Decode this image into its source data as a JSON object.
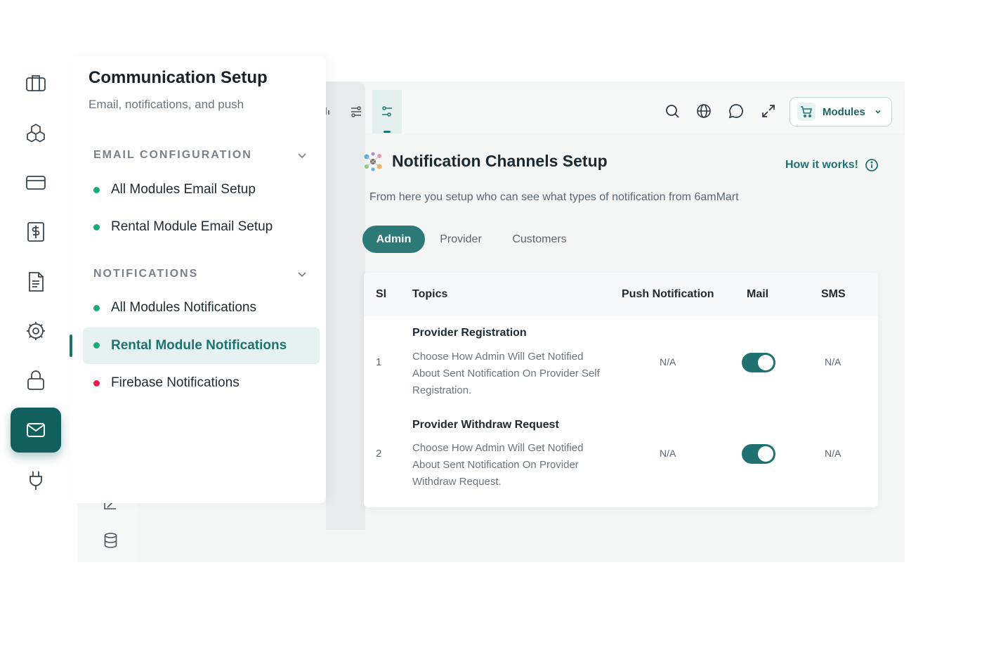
{
  "rail": {
    "icons": [
      "briefcase-icon",
      "cubes-icon",
      "card-icon",
      "dollar-receipt-icon",
      "document-icon",
      "settings-gear-icon",
      "lock-icon",
      "mail-icon",
      "plug-icon"
    ],
    "active": "mail-icon"
  },
  "panel": {
    "title": "Communication Setup",
    "subtitle": "Email, notifications, and push",
    "sections": [
      {
        "heading": "EMAIL CONFIGURATION",
        "items": [
          {
            "label": "All Modules Email Setup",
            "dot_color": "#1bab76"
          },
          {
            "label": "Rental Module Email Setup",
            "dot_color": "#1bab76"
          }
        ]
      },
      {
        "heading": "NOTIFICATIONS",
        "items": [
          {
            "label": "All Modules Notifications",
            "dot_color": "#1bab76"
          },
          {
            "label": "Rental Module Notifications",
            "dot_color": "#1bab76",
            "active": true
          },
          {
            "label": "Firebase Notifications",
            "dot_color": "#e8204f"
          }
        ]
      }
    ]
  },
  "topbar": {
    "icons": [
      "search-icon",
      "globe-icon",
      "chat-icon",
      "expand-icon"
    ],
    "modules_label": "Modules"
  },
  "main": {
    "title": "Notification Channels Setup",
    "how_it_works": "How it works!",
    "description": "From here you setup who can see what types of notification from 6amMart",
    "tabs": [
      {
        "label": "Admin",
        "active": true
      },
      {
        "label": "Provider",
        "active": false
      },
      {
        "label": "Customers",
        "active": false
      }
    ],
    "table": {
      "headers": [
        "Sl",
        "Topics",
        "Push Notification",
        "Mail",
        "SMS"
      ],
      "rows": [
        {
          "sl": "1",
          "title": "Provider Registration",
          "description": "Choose How Admin Will Get Notified About Sent Notification On Provider Self Registration.",
          "push": "N/A",
          "mail_enabled": true,
          "sms": "N/A"
        },
        {
          "sl": "2",
          "title": "Provider Withdraw Request",
          "description": "Choose How Admin Will Get Notified About Sent Notification On Provider Withdraw Request.",
          "push": "N/A",
          "mail_enabled": true,
          "sms": "N/A"
        }
      ]
    }
  },
  "colors": {
    "accent": "#1f7270",
    "active_rail": "#12605e",
    "dot_green": "#1bab76",
    "dot_red": "#e8204f"
  }
}
